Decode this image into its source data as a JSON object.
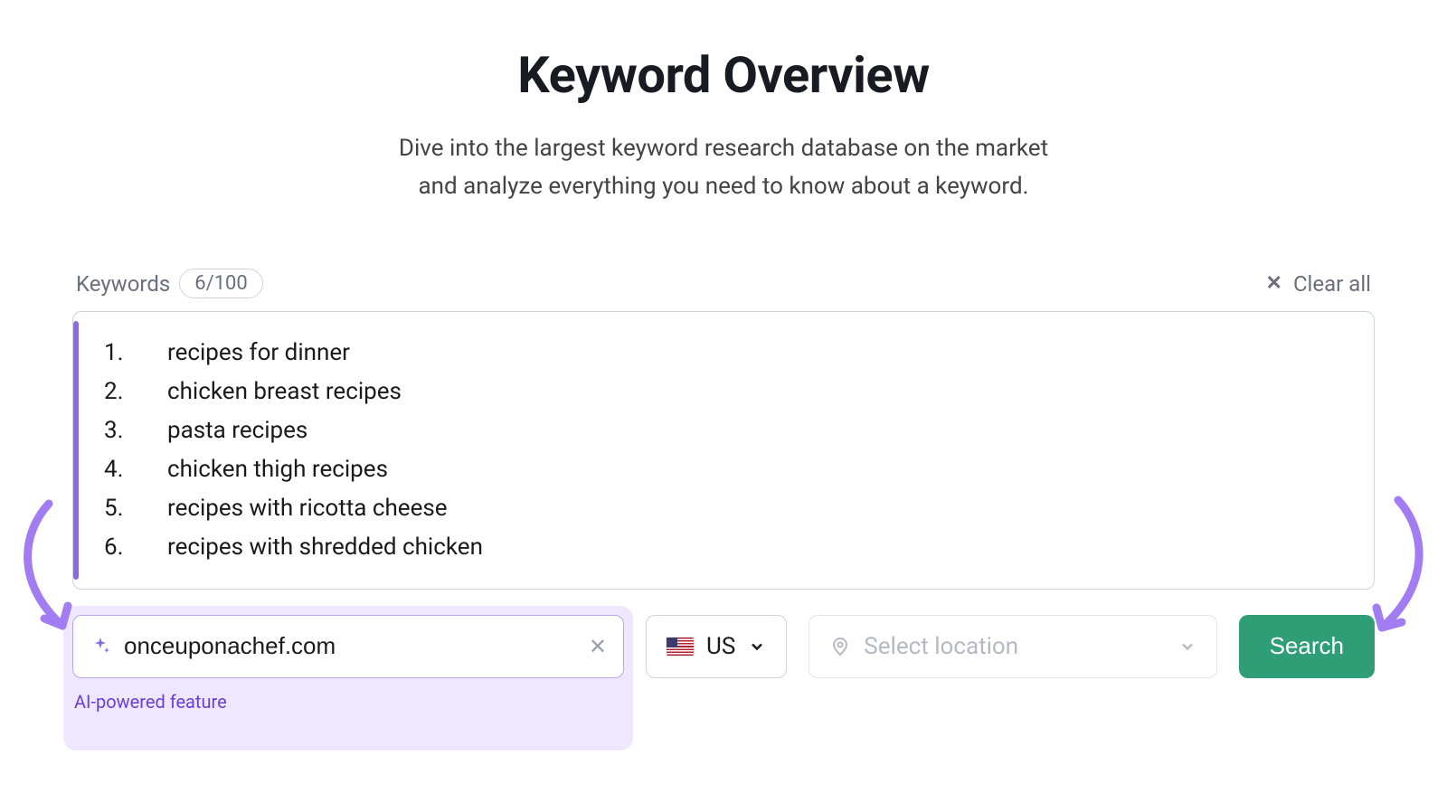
{
  "header": {
    "title": "Keyword Overview",
    "subtitle_line1": "Dive into the largest keyword research database on the market",
    "subtitle_line2": "and analyze everything you need to know about a keyword."
  },
  "keywords_section": {
    "label": "Keywords",
    "count_badge": "6/100",
    "clear_all_label": "Clear all",
    "items": [
      "recipes for dinner",
      "chicken breast recipes",
      "pasta recipes",
      "chicken thigh recipes",
      "recipes with ricotta cheese",
      "recipes with shredded chicken"
    ]
  },
  "controls": {
    "ai_domain": {
      "value": "onceuponachef.com",
      "caption": "AI-powered feature",
      "sparkle_icon": "sparkle-icon"
    },
    "country": {
      "code": "US",
      "flag_icon": "us-flag-icon"
    },
    "location": {
      "placeholder": "Select location",
      "pin_icon": "location-pin-icon"
    },
    "search_button": "Search"
  }
}
